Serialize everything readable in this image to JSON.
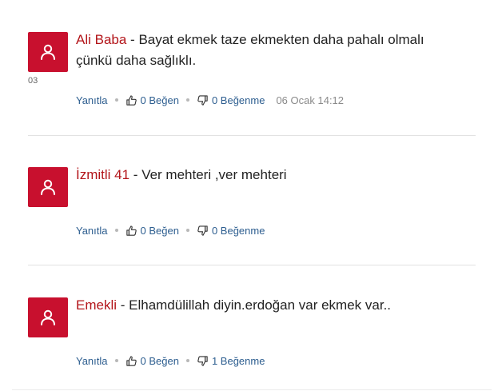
{
  "comments": [
    {
      "author": "Ali Baba",
      "separator": " - ",
      "text": "Bayat ekmek taze ekmekten daha pahalı olmalı çünkü daha sağlıklı.",
      "side_note": "03",
      "reply_label": "Yanıtla",
      "like_label": "0 Beğen",
      "dislike_label": "0 Beğenme",
      "date": "06 Ocak 14:12"
    },
    {
      "author": "İzmitli 41",
      "separator": " - ",
      "text": "Ver mehteri ,ver mehteri",
      "reply_label": "Yanıtla",
      "like_label": "0 Beğen",
      "dislike_label": "0 Beğenme"
    },
    {
      "author": "Emekli",
      "separator": " - ",
      "text": "Elhamdülillah diyin.erdoğan var ekmek var..",
      "reply_label": "Yanıtla",
      "like_label": "0 Beğen",
      "dislike_label": "1 Beğenme"
    }
  ],
  "icons": {
    "avatar": "user-icon",
    "like": "thumbs-up-icon",
    "dislike": "thumbs-down-icon"
  },
  "colors": {
    "avatar_bg": "#c8102e",
    "author": "#b3151a",
    "action_link": "#2c5d8f",
    "date": "#8a8a8a"
  }
}
